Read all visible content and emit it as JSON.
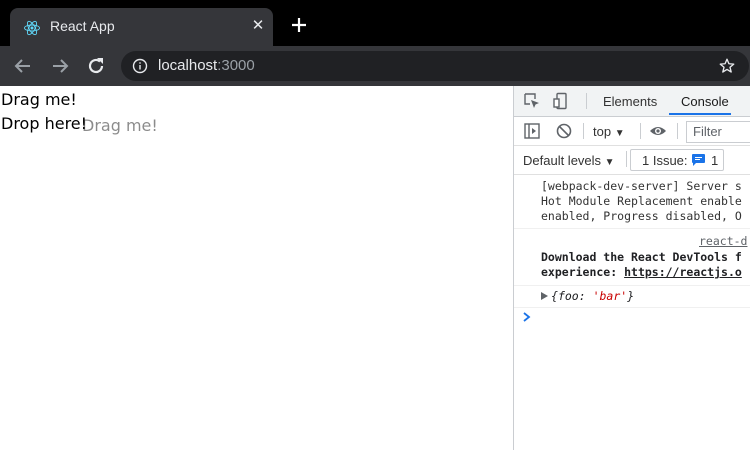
{
  "browser": {
    "tab_title": "React App",
    "tab_close": "✕",
    "url_host": "localhost",
    "url_port": ":3000"
  },
  "page": {
    "drag_text": "Drag me!",
    "drop_text": "Drop here!",
    "ghost_text": "Drag me!"
  },
  "devtools": {
    "tabs": [
      "Elements",
      "Console"
    ],
    "active_tab": "Console",
    "context": "top",
    "filter_placeholder": "Filter",
    "levels": "Default levels",
    "issues_label": "1 Issue:",
    "issues_count": "1",
    "messages": {
      "wds_line1": "[webpack-dev-server] Server s",
      "wds_line2": "Hot Module Replacement enable",
      "wds_line3": "enabled, Progress disabled, O",
      "react_source": "react-d",
      "react_line1": "Download the React DevTools f",
      "react_line2_prefix": "experience: ",
      "react_line2_link": "https://reactjs.o",
      "obj_open": "{",
      "obj_key": "foo",
      "obj_colon": ": ",
      "obj_value": "'bar'",
      "obj_close": "}"
    }
  },
  "colors": {
    "accent": "#1a73e8",
    "react": "#61dafb",
    "string": "#c80000"
  }
}
